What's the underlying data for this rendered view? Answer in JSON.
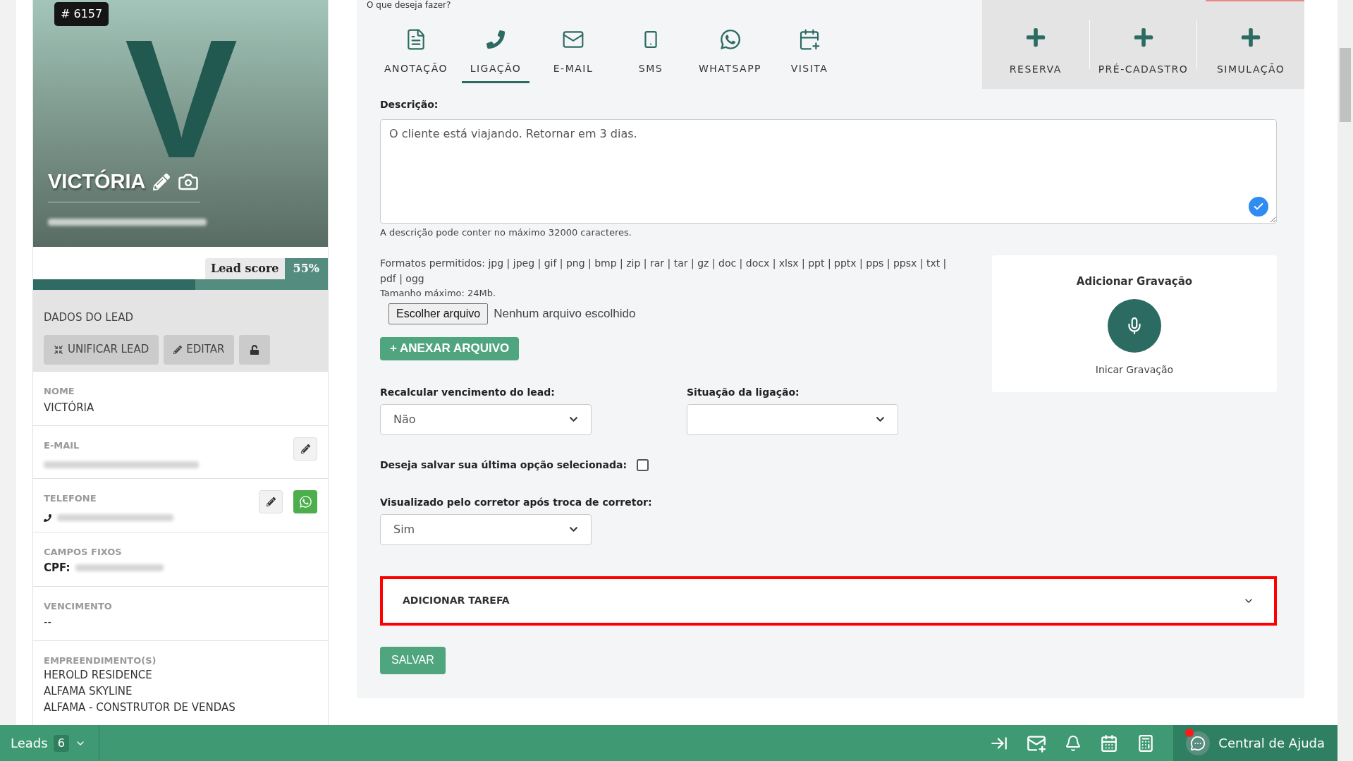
{
  "prompt": "O que deseja fazer?",
  "lead": {
    "id_badge": "# 6157",
    "avatar_initial": "V",
    "name": "VICTÓRIA",
    "score_label": "Lead score",
    "score_value": "55%",
    "level": 0.55
  },
  "lead_data": {
    "title": "DADOS DO LEAD",
    "buttons": [
      "UNIFICAR LEAD",
      "EDITAR"
    ]
  },
  "fields": [
    {
      "kind": "text",
      "label": "NOME",
      "value": "VICTÓRIA"
    },
    {
      "kind": "blurred",
      "label": "E-MAIL"
    },
    {
      "kind": "phone",
      "label": "TELEFONE"
    },
    {
      "kind": "cpf",
      "label": "CAMPOS FIXOS",
      "prefix": "CPF:"
    },
    {
      "kind": "text",
      "label": "VENCIMENTO",
      "value": "--"
    },
    {
      "kind": "list",
      "label": "EMPREENDIMENTO(S)",
      "values": [
        "HEROLD RESIDENCE",
        "ALFAMA SKYLINE",
        "ALFAMA - CONSTRUTOR DE VENDAS"
      ]
    }
  ],
  "activity_tabs": [
    {
      "label": "ANOTAÇÃO",
      "selected": false
    },
    {
      "label": "LIGAÇÃO",
      "selected": true
    },
    {
      "label": "E-MAIL",
      "selected": false
    },
    {
      "label": "SMS",
      "selected": false
    },
    {
      "label": "WHATSAPP",
      "selected": false
    },
    {
      "label": "VISITA",
      "selected": false
    }
  ],
  "quick_actions": [
    "RESERVA",
    "PRÉ-CADASTRO",
    "SIMULAÇÃO"
  ],
  "form": {
    "description_label": "Descrição:",
    "description": "O cliente está viajando. Retornar em 3 dias.",
    "description_hint": "A descrição pode conter no máximo 32000 caracteres.",
    "formats": "Formatos permitidos: jpg | jpeg | gif | png | bmp | zip | rar | tar | gz | doc | docx | xlsx | ppt | pptx | pps | ppsx | txt | pdf | ogg",
    "max_size": "Tamanho máximo: 24Mb.",
    "file_button": "Escolher arquivo",
    "file_status": "Nenhum arquivo escolhido",
    "attach_button": "+ ANEXAR ARQUIVO",
    "recalc_label": "Recalcular vencimento do lead:",
    "recalc_value": "Não",
    "call_status_label": "Situação da ligação:",
    "save_option_label": "Deseja salvar sua última opção selecionada:",
    "save_option_checked": false,
    "viewed_label": "Visualizado pelo corretor após troca de corretor:",
    "viewed_value": "Sim",
    "task_title": "ADICIONAR TAREFA",
    "task_expanded": false,
    "task_highlighted": true,
    "save_button": "SALVAR"
  },
  "recording": {
    "title": "Adicionar Gravação",
    "action": "Inicar Gravação"
  },
  "bottom_bar": {
    "label": "Leads",
    "count": "6",
    "help": "Central de Ajuda",
    "help_notification": true
  }
}
